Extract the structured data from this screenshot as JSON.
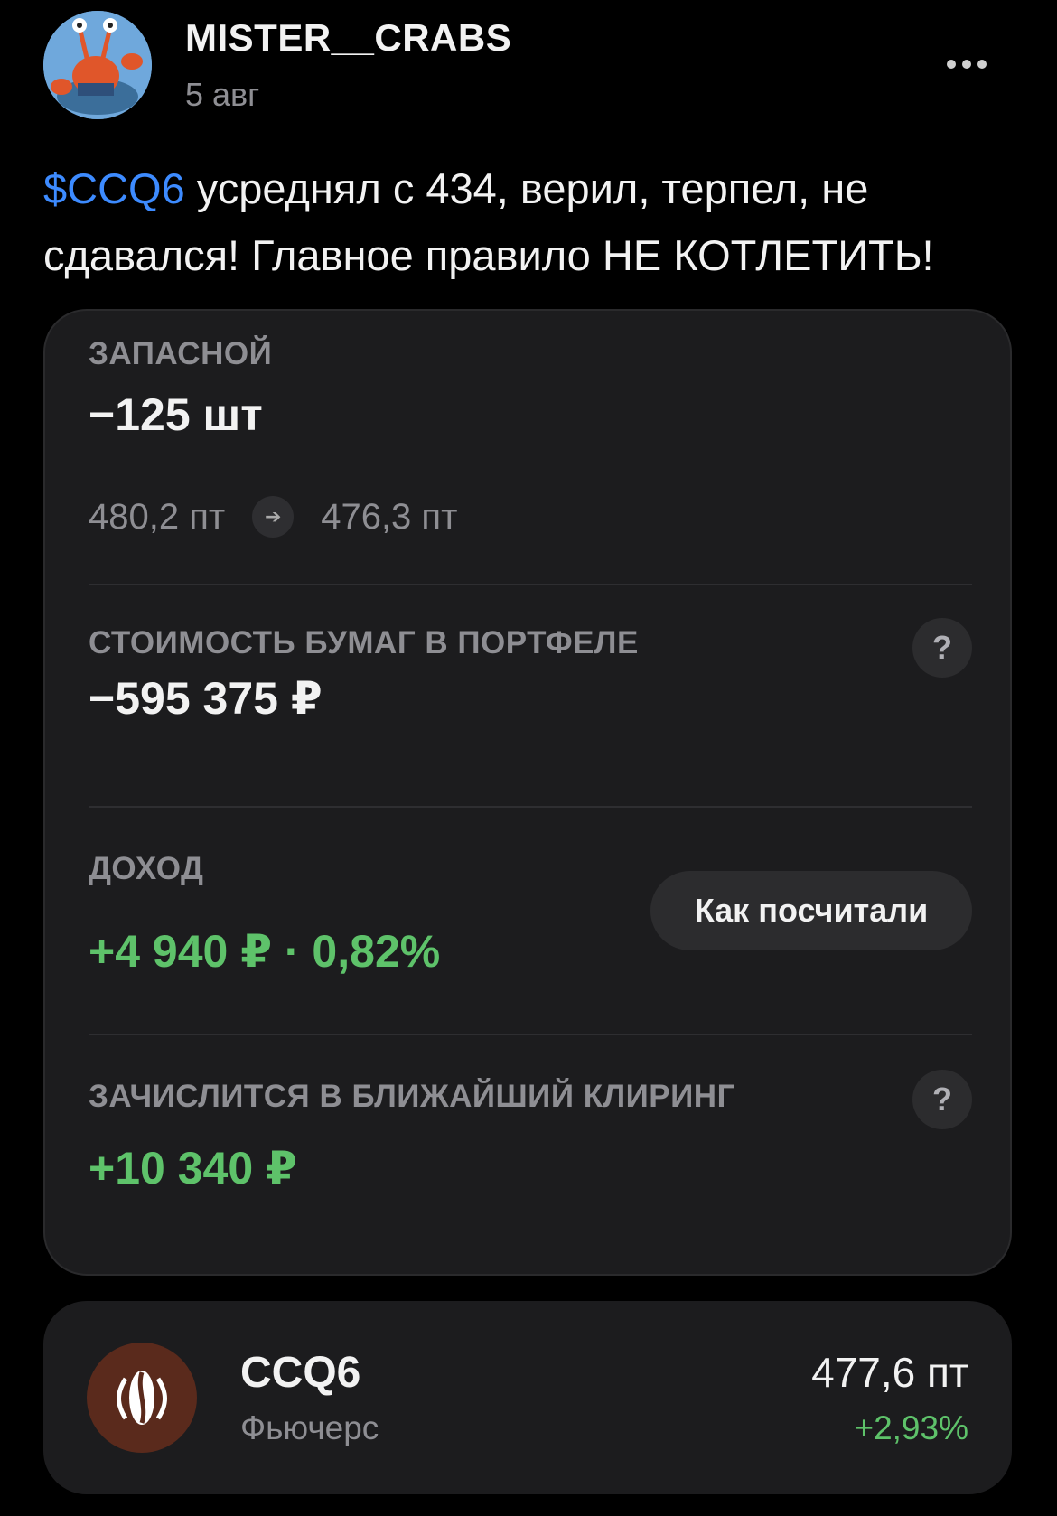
{
  "post": {
    "author": "MISTER__CRABS",
    "date": "5 авг",
    "ticker": "$CCQ6",
    "text": " усреднял с 434, верил, терпел, не сдавался! Главное правило НЕ КОТЛЕТИТЬ!"
  },
  "card": {
    "account_label": "ЗАПАСНОЙ",
    "quantity": "−125 шт",
    "price_from": "480,2 пт",
    "price_to": "476,3 пт",
    "value_label": "СТОИМОСТЬ БУМАГ В ПОРТФЕЛЕ",
    "value": "−595 375 ₽",
    "income_label": "ДОХОД",
    "income": "+4 940 ₽ · 0,82%",
    "calc_button": "Как посчитали",
    "clearing_label": "ЗАЧИСЛИТСЯ В БЛИЖАЙШИЙ КЛИРИНГ",
    "clearing_value": "+10 340 ₽",
    "help_glyph": "?"
  },
  "instrument": {
    "name": "CCQ6",
    "type": "Фьючерс",
    "price": "477,6 пт",
    "change": "+2,93%"
  },
  "colors": {
    "background": "#000000",
    "card": "#1c1c1e",
    "link": "#3d8bff",
    "positive": "#5ec26a",
    "muted": "#8e8e93"
  },
  "icons": [
    "more-dots-icon",
    "arrow-right-icon",
    "help-icon",
    "cocoa-bean-icon"
  ]
}
